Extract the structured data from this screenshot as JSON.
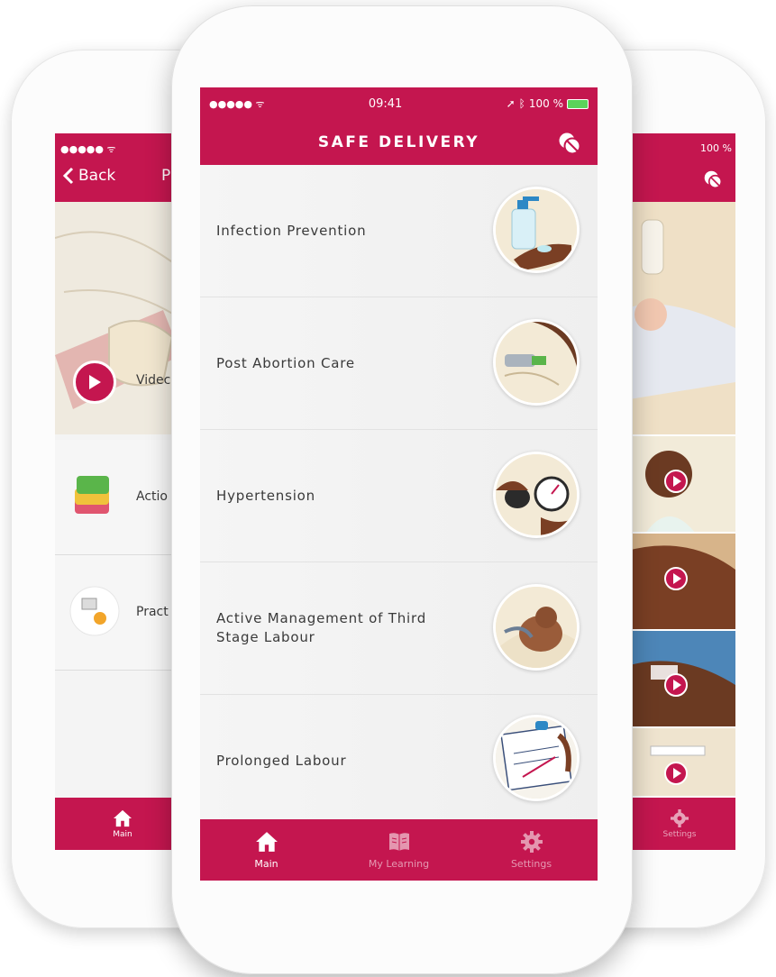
{
  "colors": {
    "accent": "#c4164f",
    "background": "#f2f2f2",
    "text": "#3a3a3a"
  },
  "center": {
    "status": {
      "signal": "●●●●● ᯤ",
      "time": "09:41",
      "battery": "100 %"
    },
    "title": "SAFE DELIVERY",
    "header_icon": "pill-icon",
    "modules": [
      {
        "label": "Infection Prevention",
        "icon": "hand-sanitizer-illustration"
      },
      {
        "label": "Post Abortion Care",
        "icon": "procedure-illustration"
      },
      {
        "label": "Hypertension",
        "icon": "blood-pressure-cuff-illustration"
      },
      {
        "label": "Active Management of Third Stage Labour",
        "icon": "newborn-illustration"
      },
      {
        "label": "Prolonged Labour",
        "icon": "partograph-illustration"
      }
    ],
    "tabs": [
      {
        "label": "Main",
        "icon": "home-icon",
        "active": true
      },
      {
        "label": "My Learning",
        "icon": "book-icon",
        "active": false
      },
      {
        "label": "Settings",
        "icon": "gear-icon",
        "active": false
      }
    ]
  },
  "left": {
    "status": "●●●●● ᯤ",
    "back_label": "Back",
    "title_fragment": "P",
    "rows": [
      {
        "label": "Videc",
        "icon": "play-icon"
      },
      {
        "label": "Actio",
        "icon": "cards-icon"
      },
      {
        "label": "Pract",
        "icon": "drill-icon"
      }
    ],
    "tab_label": "Main"
  },
  "right": {
    "status": "100 %",
    "tab_label": "Settings"
  }
}
